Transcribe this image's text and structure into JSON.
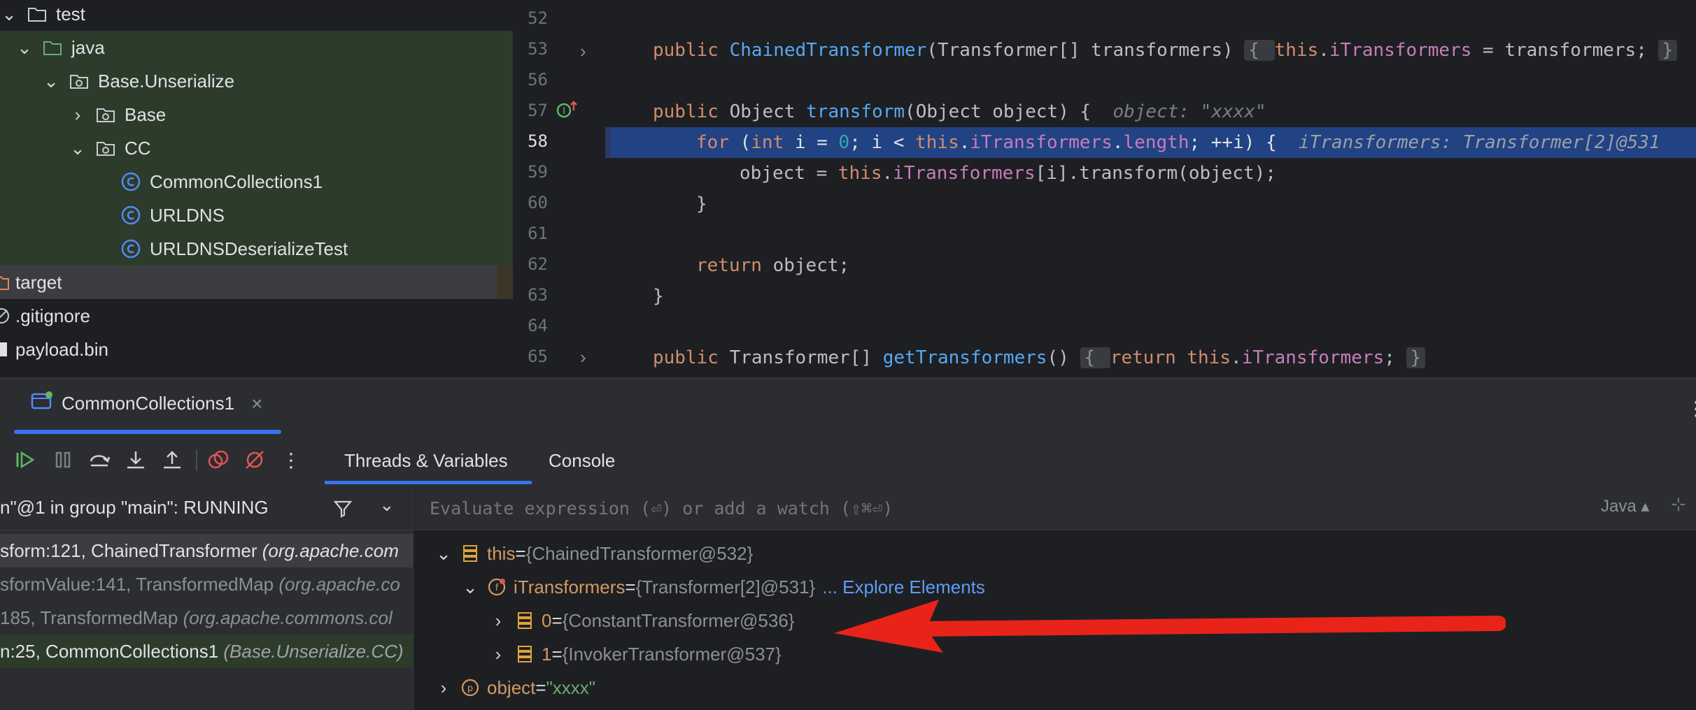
{
  "project_tree": {
    "items": [
      {
        "label": "test"
      },
      {
        "label": "java"
      },
      {
        "label": "Base.Unserialize"
      },
      {
        "label": "Base"
      },
      {
        "label": "CC"
      },
      {
        "label": "CommonCollections1"
      },
      {
        "label": "URLDNS"
      },
      {
        "label": "URLDNSDeserializeTest"
      },
      {
        "label": "target"
      },
      {
        "label": ".gitignore"
      },
      {
        "label": "payload.bin"
      }
    ]
  },
  "editor": {
    "line_numbers": [
      "52",
      "53",
      "56",
      "57",
      "58",
      "59",
      "60",
      "61",
      "62",
      "63",
      "64",
      "65"
    ],
    "lines": {
      "l53a": "public ",
      "l53b": "ChainedTransformer",
      "l53c": "(Transformer[] transformers) ",
      "l53d": "{ ",
      "l53e": "this",
      "l53f": ".",
      "l53g": "iTransformers",
      "l53h": " = transformers; ",
      "l53i": "}",
      "l57a": "public ",
      "l57b": "Object ",
      "l57c": "transform",
      "l57d": "(Object object) {  ",
      "l57e": "object: \"xxxx\"",
      "l58a": "for ",
      "l58b": "(",
      "l58c": "int ",
      "l58d": "i = ",
      "l58e": "0",
      "l58f": "; i < ",
      "l58g": "this",
      "l58h": ".",
      "l58i": "iTransformers",
      "l58j": ".",
      "l58k": "length",
      "l58l": "; ++i) {  ",
      "l58m": "iTransformers: Transformer[2]@531",
      "l59a": "object = ",
      "l59b": "this",
      "l59c": ".",
      "l59d": "iTransformers",
      "l59e": "[i].transform(object);",
      "l60": "}",
      "l62a": "return ",
      "l62b": "object;",
      "l63": "}",
      "l65a": "public ",
      "l65b": "Transformer[] ",
      "l65c": "getTransformers",
      "l65d": "() ",
      "l65e": "{ ",
      "l65f": "return ",
      "l65g": "this",
      "l65h": ".",
      "l65i": "iTransformers",
      "l65j": "; ",
      "l65k": "}"
    }
  },
  "debug": {
    "session_tab": "CommonCollections1",
    "subtabs": {
      "threads": "Threads & Variables",
      "console": "Console"
    },
    "thread_selector": "n\"@1 in group \"main\": RUNNING",
    "frames": [
      {
        "method": "sform:121, ChainedTransformer ",
        "cls": "(org.apache.com"
      },
      {
        "method": "sformValue:141, TransformedMap ",
        "cls": "(org.apache.co"
      },
      {
        "method": "185, TransformedMap ",
        "cls": "(org.apache.commons.col"
      },
      {
        "method": "n:25, CommonCollections1 ",
        "cls": "(Base.Unserialize.CC)"
      }
    ],
    "eval_placeholder": "Evaluate expression (⏎) or add a watch (⇧⌘⏎)",
    "lang": "Java",
    "variables": [
      {
        "name": "this",
        "eq": " = ",
        "value": "{ChainedTransformer@532}"
      },
      {
        "name": "iTransformers",
        "eq": " = ",
        "value": "{Transformer[2]@531}",
        "link": "... Explore Elements"
      },
      {
        "name": "0",
        "eq": " = ",
        "value": "{ConstantTransformer@536}"
      },
      {
        "name": "1",
        "eq": " = ",
        "value": "{InvokerTransformer@537}"
      },
      {
        "name": "object",
        "eq": " = ",
        "value": "\"xxxx\""
      }
    ]
  },
  "colors": {
    "arrow": "#e8231a",
    "highlight": "#214283",
    "accent": "#3574f0"
  }
}
